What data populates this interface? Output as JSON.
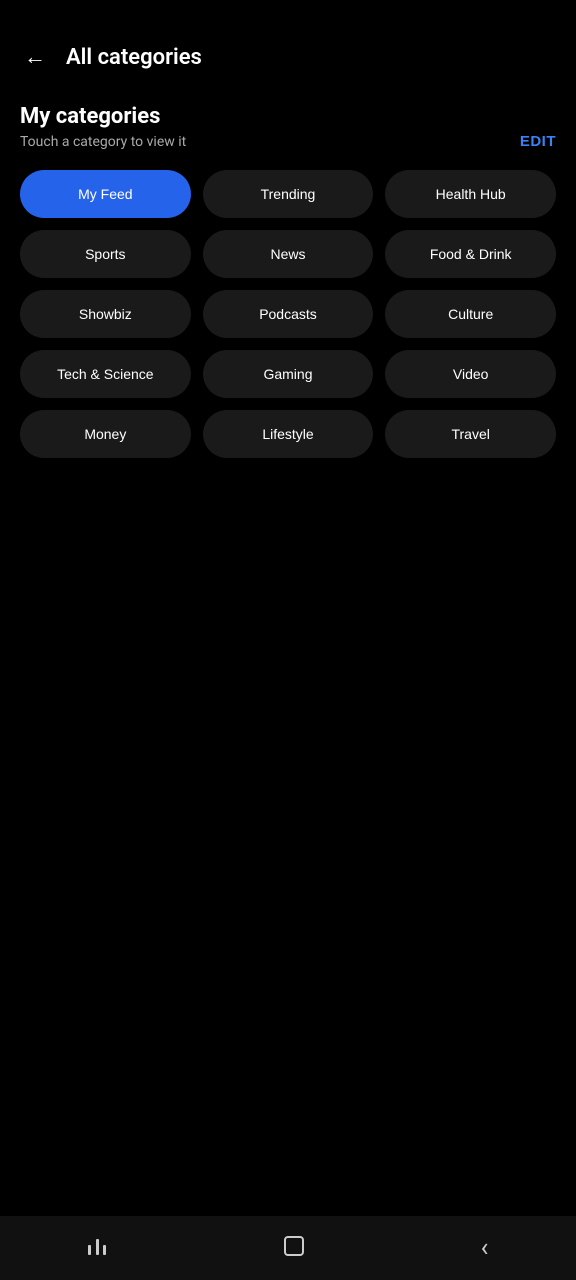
{
  "header": {
    "title": "All categories",
    "back_label": "←"
  },
  "section": {
    "title": "My categories",
    "subtitle": "Touch a category to view it",
    "edit_label": "EDIT"
  },
  "categories": [
    {
      "id": "my-feed",
      "label": "My Feed",
      "active": true
    },
    {
      "id": "trending",
      "label": "Trending",
      "active": false
    },
    {
      "id": "health-hub",
      "label": "Health Hub",
      "active": false
    },
    {
      "id": "sports",
      "label": "Sports",
      "active": false
    },
    {
      "id": "news",
      "label": "News",
      "active": false
    },
    {
      "id": "food-drink",
      "label": "Food & Drink",
      "active": false
    },
    {
      "id": "showbiz",
      "label": "Showbiz",
      "active": false
    },
    {
      "id": "podcasts",
      "label": "Podcasts",
      "active": false
    },
    {
      "id": "culture",
      "label": "Culture",
      "active": false
    },
    {
      "id": "tech-science",
      "label": "Tech & Science",
      "active": false
    },
    {
      "id": "gaming",
      "label": "Gaming",
      "active": false
    },
    {
      "id": "video",
      "label": "Video",
      "active": false
    },
    {
      "id": "money",
      "label": "Money",
      "active": false
    },
    {
      "id": "lifestyle",
      "label": "Lifestyle",
      "active": false
    },
    {
      "id": "travel",
      "label": "Travel",
      "active": false
    }
  ],
  "navbar": {
    "recents_label": "|||",
    "home_label": "□",
    "back_label": "‹"
  }
}
